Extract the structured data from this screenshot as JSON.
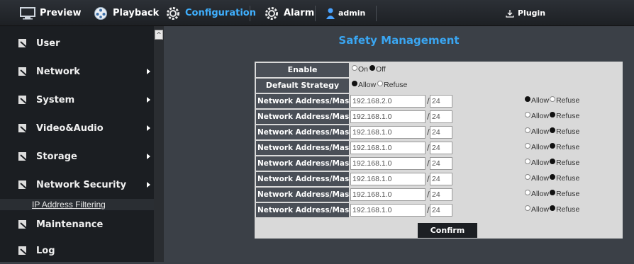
{
  "topbar": {
    "preview": "Preview",
    "playback": "Playback",
    "configuration": "Configuration",
    "alarm": "Alarm",
    "user": "admin",
    "plugin": "Plugin"
  },
  "sidebar": {
    "items": [
      {
        "label": "User",
        "has_submenu": false
      },
      {
        "label": "Network",
        "has_submenu": true
      },
      {
        "label": "System",
        "has_submenu": true
      },
      {
        "label": "Video&Audio",
        "has_submenu": true
      },
      {
        "label": "Storage",
        "has_submenu": true
      },
      {
        "label": "Network Security",
        "has_submenu": true
      },
      {
        "label": "Maintenance",
        "has_submenu": false
      },
      {
        "label": "Log",
        "has_submenu": false
      }
    ],
    "subitem": "IP Address Filtering"
  },
  "main": {
    "title": "Safety Management",
    "enable_label": "Enable",
    "enable_on": "On",
    "enable_off": "Off",
    "enable_value": "Off",
    "strategy_label": "Default Strategy",
    "strategy_allow": "Allow",
    "strategy_refuse": "Refuse",
    "strategy_value": "Allow",
    "rows": [
      {
        "label": "Network Address/Mask",
        "ip": "192.168.2.0",
        "mask": "24",
        "allow": "Allow",
        "refuse": "Refuse",
        "selected": "Allow"
      },
      {
        "label": "Network Address/Mask",
        "ip": "192.168.1.0",
        "mask": "24",
        "allow": "Allow",
        "refuse": "Refuse",
        "selected": "Refuse"
      },
      {
        "label": "Network Address/Mask",
        "ip": "192.168.1.0",
        "mask": "24",
        "allow": "Allow",
        "refuse": "Refuse",
        "selected": "Refuse"
      },
      {
        "label": "Network Address/Mask",
        "ip": "192.168.1.0",
        "mask": "24",
        "allow": "Allow",
        "refuse": "Refuse",
        "selected": "Refuse"
      },
      {
        "label": "Network Address/Mask",
        "ip": "192.168.1.0",
        "mask": "24",
        "allow": "Allow",
        "refuse": "Refuse",
        "selected": "Refuse"
      },
      {
        "label": "Network Address/Mask",
        "ip": "192.168.1.0",
        "mask": "24",
        "allow": "Allow",
        "refuse": "Refuse",
        "selected": "Refuse"
      },
      {
        "label": "Network Address/Mask",
        "ip": "192.168.1.0",
        "mask": "24",
        "allow": "Allow",
        "refuse": "Refuse",
        "selected": "Refuse"
      },
      {
        "label": "Network Address/Mask",
        "ip": "192.168.1.0",
        "mask": "24",
        "allow": "Allow",
        "refuse": "Refuse",
        "selected": "Refuse"
      }
    ],
    "confirm": "Confirm"
  },
  "colors": {
    "accent": "#3aa6f2",
    "topbar": "#1d2024",
    "sidebar": "#1b1e22",
    "panel": "#d9d9d9"
  }
}
